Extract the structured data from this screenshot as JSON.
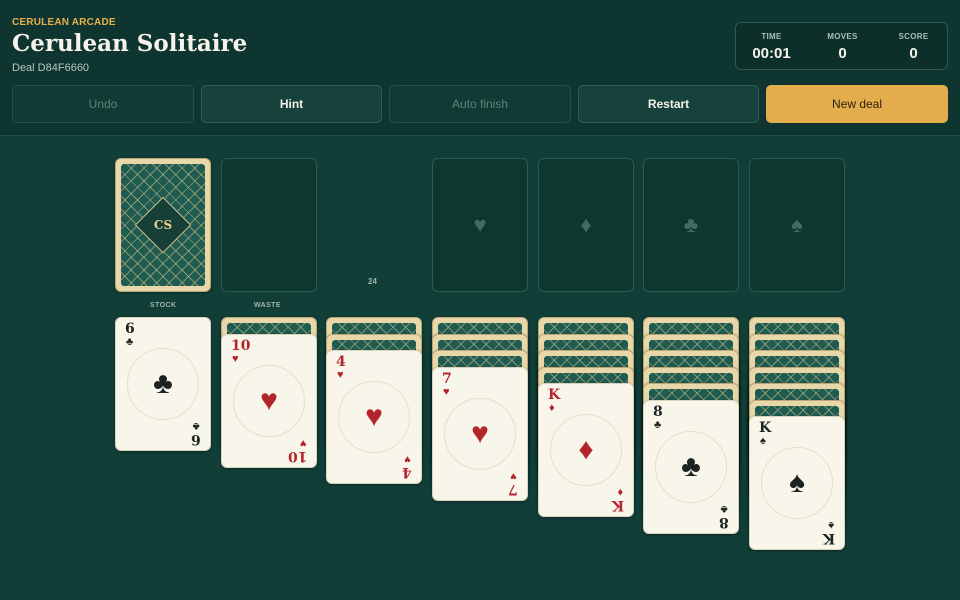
{
  "header": {
    "brand": "CERULEAN ARCADE",
    "title": "Cerulean Solitaire",
    "deal": "Deal D84F6660"
  },
  "stats": [
    {
      "label": "TIME",
      "value": "00:01"
    },
    {
      "label": "MOVES",
      "value": "0"
    },
    {
      "label": "SCORE",
      "value": "0"
    }
  ],
  "buttons": {
    "undo": "Undo",
    "hint": "Hint",
    "auto_finish": "Auto finish",
    "restart": "Restart",
    "new_deal": "New deal"
  },
  "board": {
    "stock_label": "STOCK",
    "waste_label": "WASTE",
    "stock_count": "24",
    "card_back_emblem": "CS",
    "foundations": [
      "♥",
      "♦",
      "♣",
      "♠"
    ],
    "tableau": [
      {
        "face_down": 0,
        "rank": "6",
        "suit": "♣",
        "color": "black"
      },
      {
        "face_down": 1,
        "rank": "10",
        "suit": "♥",
        "color": "red"
      },
      {
        "face_down": 2,
        "rank": "4",
        "suit": "♥",
        "color": "red"
      },
      {
        "face_down": 3,
        "rank": "7",
        "suit": "♥",
        "color": "red"
      },
      {
        "face_down": 4,
        "rank": "K",
        "suit": "♦",
        "color": "red"
      },
      {
        "face_down": 5,
        "rank": "8",
        "suit": "♣",
        "color": "black"
      },
      {
        "face_down": 6,
        "rank": "K",
        "suit": "♠",
        "color": "black"
      }
    ]
  },
  "colors": {
    "accent": "#e3ad4d",
    "felt": "#113f38",
    "red_suit": "#b3242b",
    "black_suit": "#1c2321"
  }
}
